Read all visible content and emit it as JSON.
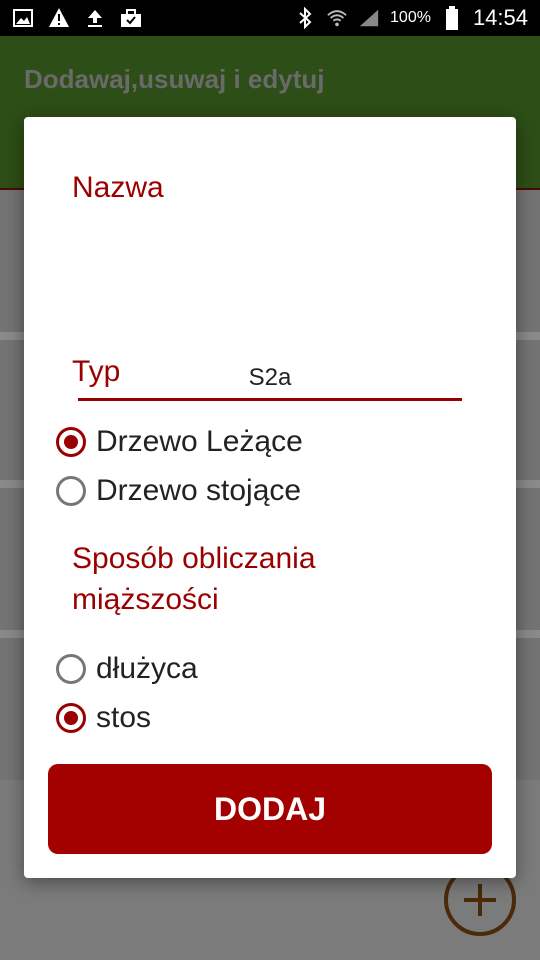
{
  "status_bar": {
    "battery_text": "100%",
    "time": "14:54",
    "icons": [
      "gallery-icon",
      "warning-icon",
      "upload-icon",
      "briefcase-icon",
      "bluetooth-icon",
      "wifi-icon",
      "signal-icon",
      "battery-icon"
    ]
  },
  "app_bar": {
    "title": "Dodawaj,usuwaj i edytuj"
  },
  "dialog": {
    "name_label": "Nazwa",
    "name_value": "S2a",
    "type_label": "Typ",
    "type_options": [
      {
        "label": "Drzewo Leżące",
        "checked": true
      },
      {
        "label": "Drzewo stojące",
        "checked": false
      }
    ],
    "method_label_line1": "Sposób obliczania",
    "method_label_line2": "miąższości",
    "method_options": [
      {
        "label": "dłużyca",
        "checked": false
      },
      {
        "label": "stos",
        "checked": true
      }
    ],
    "submit_label": "DODAJ"
  },
  "colors": {
    "accent": "#9b0000",
    "button": "#a30000",
    "appbar": "#2d4e16"
  }
}
